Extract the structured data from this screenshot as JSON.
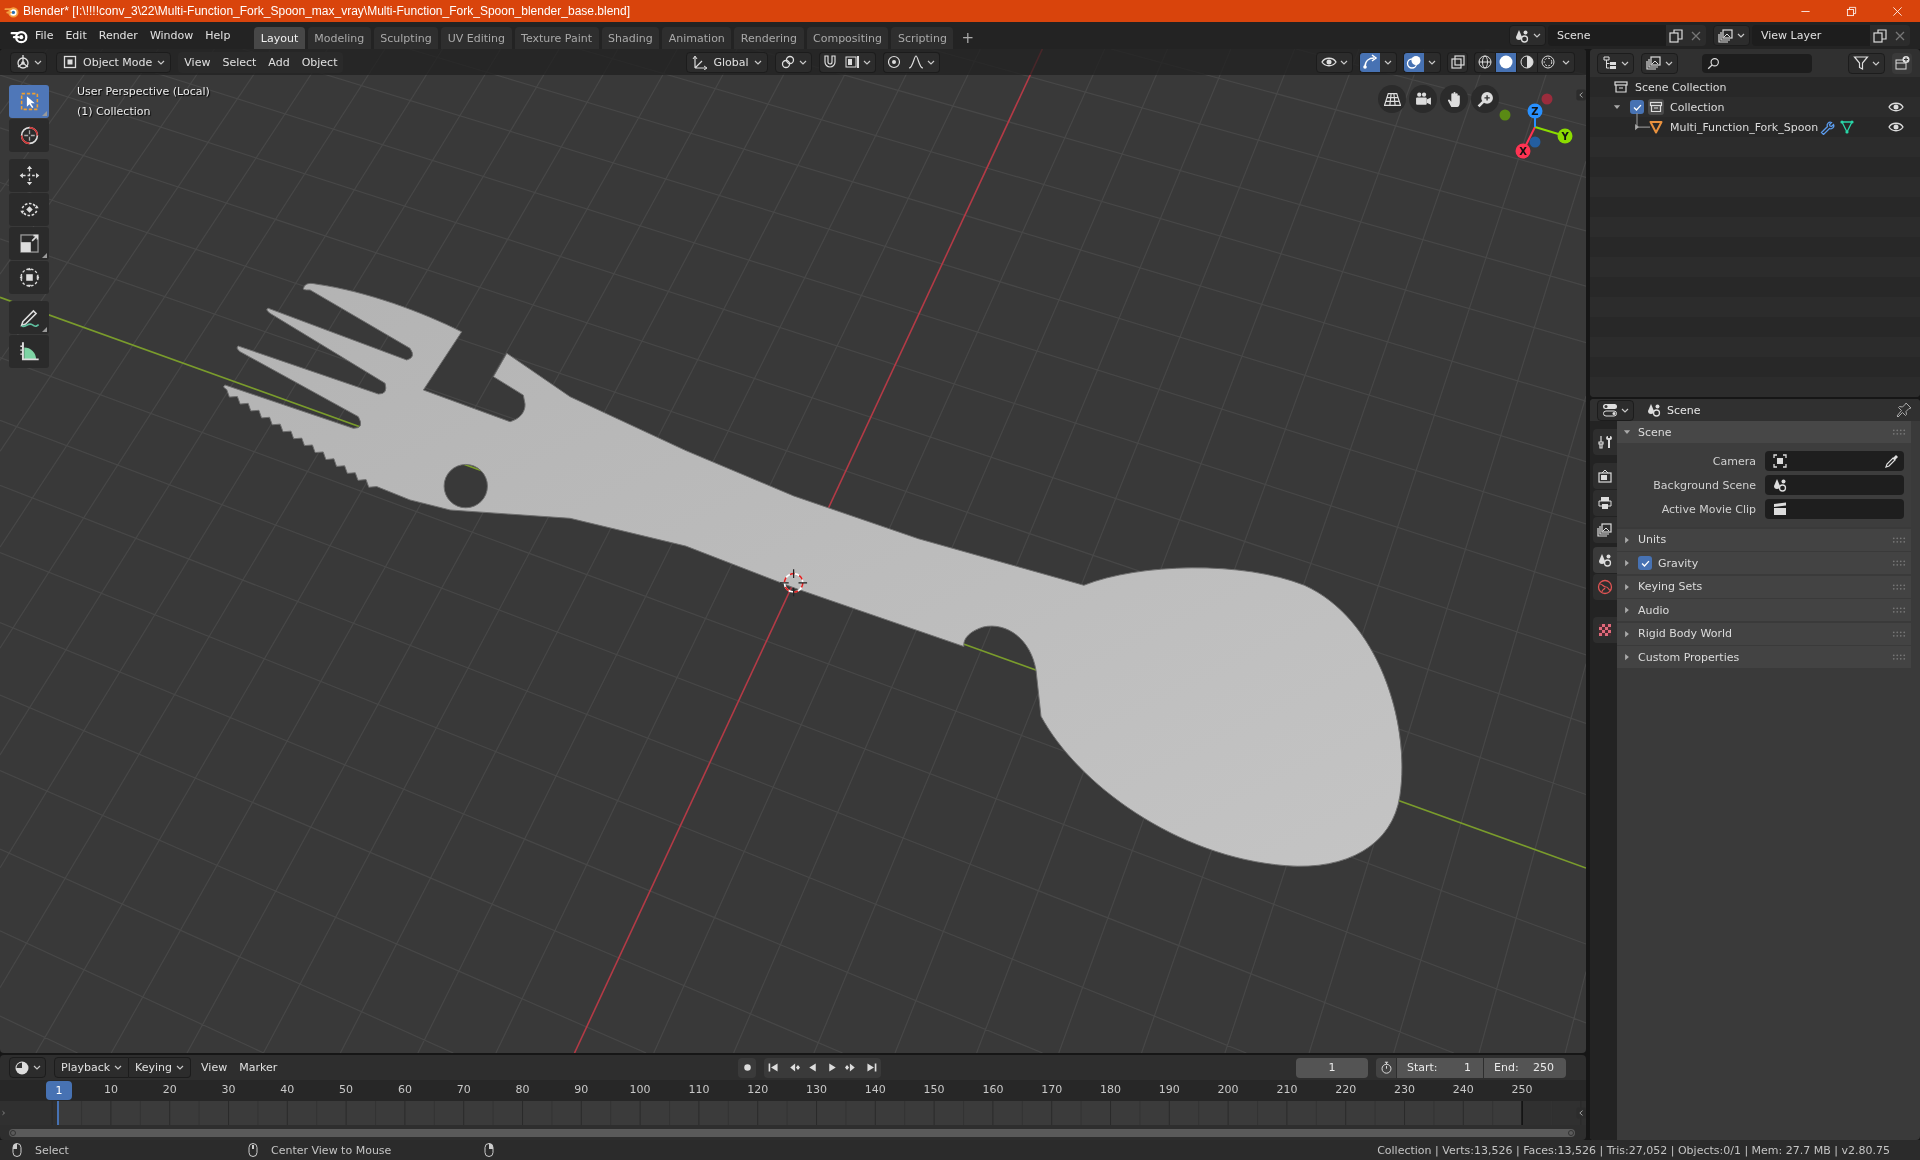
{
  "title_bar": {
    "title": "Blender* [I:\\!!!!conv_3\\22\\Multi-Function_Fork_Spoon_max_vray\\Multi-Function_Fork_Spoon_blender_base.blend]"
  },
  "top_bar": {
    "menus": [
      "File",
      "Edit",
      "Render",
      "Window",
      "Help"
    ],
    "workspaces": [
      {
        "label": "Layout",
        "selected": true
      },
      {
        "label": "Modeling",
        "selected": false
      },
      {
        "label": "Sculpting",
        "selected": false
      },
      {
        "label": "UV Editing",
        "selected": false
      },
      {
        "label": "Texture Paint",
        "selected": false
      },
      {
        "label": "Shading",
        "selected": false
      },
      {
        "label": "Animation",
        "selected": false
      },
      {
        "label": "Rendering",
        "selected": false
      },
      {
        "label": "Compositing",
        "selected": false
      },
      {
        "label": "Scripting",
        "selected": false
      }
    ],
    "add_workspace": "+",
    "scene": "Scene",
    "view_layer": "View Layer"
  },
  "viewport": {
    "header": {
      "mode": "Object Mode",
      "menus": [
        "View",
        "Select",
        "Add",
        "Object"
      ],
      "orientation": "Global",
      "snap": {
        "on": false
      },
      "proportional_editing": {
        "on": false
      },
      "gizmos": {
        "on": true
      },
      "overlays": {
        "on": true
      },
      "xray": {
        "on": false
      },
      "shading": [
        {
          "kind": "wireframe",
          "selected": false
        },
        {
          "kind": "solid",
          "selected": true
        },
        {
          "kind": "material",
          "selected": false
        },
        {
          "kind": "rendered",
          "selected": false
        }
      ]
    },
    "tools": [
      {
        "kind": "select_box",
        "selected": true
      },
      {
        "kind": "cursor",
        "selected": false
      },
      {
        "kind": "move",
        "selected": false
      },
      {
        "kind": "rotate",
        "selected": false
      },
      {
        "kind": "scale",
        "selected": false
      },
      {
        "kind": "transform",
        "selected": false
      },
      {
        "kind": "annotate",
        "selected": false
      },
      {
        "kind": "measure",
        "selected": false
      }
    ],
    "info": [
      "User Perspective (Local)",
      "(1) Collection"
    ],
    "gizmo_axes": [
      "X",
      "Y",
      "Z"
    ]
  },
  "outliner": {
    "tree": [
      {
        "label": "Scene Collection",
        "kind": "scene_collection",
        "children": [
          {
            "label": "Collection",
            "kind": "collection",
            "expanded": true,
            "checked": true,
            "visible": true,
            "children": [
              {
                "label": "Multi_Function_Fork_Spoon",
                "kind": "mesh_object",
                "expanded": false,
                "visible": true
              }
            ]
          }
        ]
      }
    ]
  },
  "properties": {
    "context": "Scene",
    "tabs": [
      {
        "kind": "tool",
        "selected": false
      },
      {
        "kind": "render",
        "selected": false
      },
      {
        "kind": "output",
        "selected": false
      },
      {
        "kind": "view_layer",
        "selected": false
      },
      {
        "kind": "scene",
        "selected": true
      },
      {
        "kind": "world",
        "selected": false
      },
      {
        "kind": "texture",
        "selected": false
      }
    ],
    "panels": [
      {
        "label": "Scene",
        "expanded": true,
        "fields": [
          {
            "label": "Camera",
            "kind": "camera"
          },
          {
            "label": "Background Scene",
            "kind": "scene"
          },
          {
            "label": "Active Movie Clip",
            "kind": "movie_clip"
          }
        ]
      },
      {
        "label": "Units",
        "expanded": false
      },
      {
        "label": "Gravity",
        "expanded": false,
        "toggle": {
          "checked": true
        }
      },
      {
        "label": "Keying Sets",
        "expanded": false
      },
      {
        "label": "Audio",
        "expanded": false
      },
      {
        "label": "Rigid Body World",
        "expanded": false
      },
      {
        "label": "Custom Properties",
        "expanded": false
      }
    ]
  },
  "timeline": {
    "menus": [
      {
        "label": "Playback",
        "kind": "dropdown"
      },
      {
        "label": "Keying",
        "kind": "dropdown"
      },
      {
        "label": "View",
        "kind": "menu"
      },
      {
        "label": "Marker",
        "kind": "menu"
      }
    ],
    "auto_keying": {
      "on": false
    },
    "current_frame": "1",
    "preview_range": {
      "on": false
    },
    "start": {
      "label": "Start:",
      "value": "1"
    },
    "end": {
      "label": "End:",
      "value": "250"
    },
    "playhead": "1",
    "ruler": [
      "10",
      "20",
      "30",
      "40",
      "50",
      "60",
      "70",
      "80",
      "90",
      "100",
      "110",
      "120",
      "130",
      "140",
      "150",
      "160",
      "170",
      "180",
      "190",
      "200",
      "210",
      "220",
      "230",
      "240",
      "250"
    ]
  },
  "status_bar": {
    "hints": [
      {
        "kind": "left_click",
        "label": "Select"
      },
      {
        "kind": "middle_click",
        "label": "Center View to Mouse"
      },
      {
        "kind": "right_click"
      }
    ],
    "stats": "Collection | Verts:13,526 | Faces:13,526 | Tris:27,052 | Objects:0/1 | Mem: 27.7 MB | v2.80.75"
  }
}
